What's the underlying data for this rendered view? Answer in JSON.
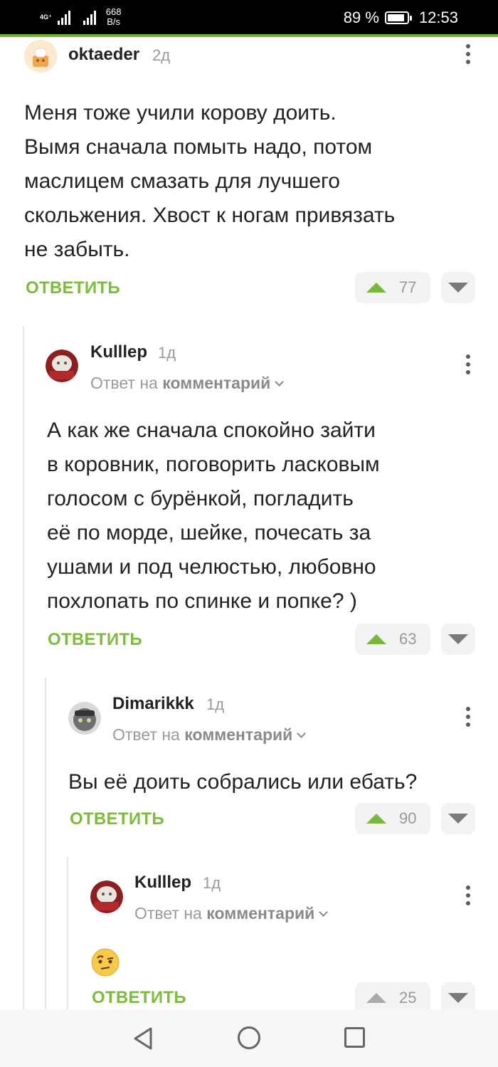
{
  "status_bar": {
    "network": "4G⁺",
    "speed_value": "668",
    "speed_unit": "B/s",
    "battery": "89 %",
    "battery_level": 0.89,
    "time": "12:53"
  },
  "colors": {
    "accent": "#7dbd3c",
    "vote_up": "#75b83b",
    "muted": "#9a9a9a"
  },
  "comments": [
    {
      "user": "oktaeder",
      "time": "2д",
      "text": [
        "Меня тоже учили корову доить.",
        "Вымя сначала помыть надо, потом",
        "маслицем смазать для лучшего",
        "скольжения. Хвост к ногам привязать",
        "не забыть."
      ],
      "reply": "ОТВЕТИТЬ",
      "votes": "77"
    },
    {
      "user": "Kulllep",
      "time": "1д",
      "reply_prefix": "Ответ на",
      "reply_target": "комментарий",
      "text": [
        "А как же сначала спокойно зайти",
        "в коровник, поговорить ласковым",
        "голосом с бурёнкой, погладить",
        "её по морде, шейке, почесать за",
        "ушами и под челюстью, любовно",
        "похлопать по спинке и попке? )"
      ],
      "reply": "ОТВЕТИТЬ",
      "votes": "63"
    },
    {
      "user": "Dimarikkk",
      "time": "1д",
      "reply_prefix": "Ответ на",
      "reply_target": "комментарий",
      "text": "Вы её доить собрались или ебать?",
      "reply": "ОТВЕТИТЬ",
      "votes": "90"
    },
    {
      "user": "Kulllep",
      "time": "1д",
      "reply_prefix": "Ответ на",
      "reply_target": "комментарий",
      "emoji": "🤨",
      "reply": "ОТВЕТИТЬ",
      "votes": "25"
    }
  ]
}
